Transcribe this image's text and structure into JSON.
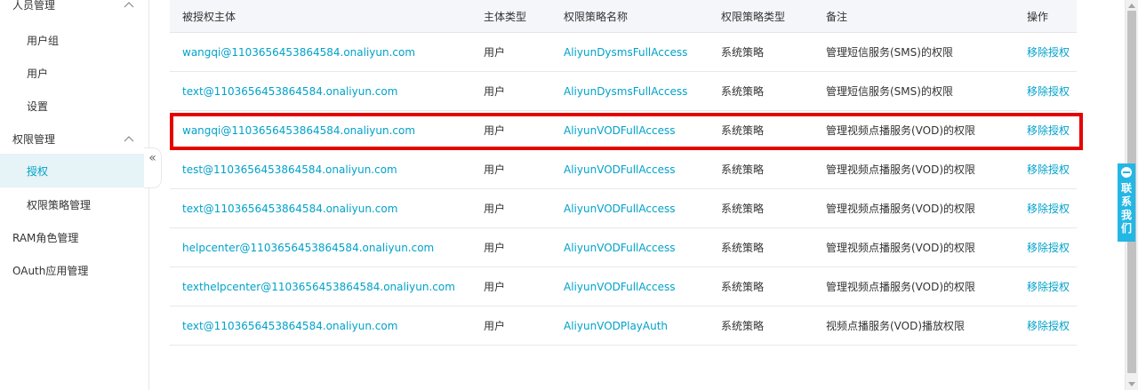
{
  "sidebar": {
    "items": [
      {
        "label": "人员管理",
        "kind": "group",
        "expanded": true
      },
      {
        "label": "用户组",
        "kind": "sub"
      },
      {
        "label": "用户",
        "kind": "sub"
      },
      {
        "label": "设置",
        "kind": "sub"
      },
      {
        "label": "权限管理",
        "kind": "group",
        "expanded": true
      },
      {
        "label": "授权",
        "kind": "sub",
        "active": true
      },
      {
        "label": "权限策略管理",
        "kind": "sub"
      },
      {
        "label": "RAM角色管理",
        "kind": "group"
      },
      {
        "label": "OAuth应用管理",
        "kind": "group"
      }
    ],
    "collapse_glyph": "«"
  },
  "table": {
    "columns": [
      "被授权主体",
      "主体类型",
      "权限策略名称",
      "权限策略类型",
      "备注",
      "操作"
    ],
    "rows": [
      {
        "principal": "wangqi@1103656453864584.onaliyun.com",
        "type": "用户",
        "policy": "AliyunDysmsFullAccess",
        "policy_type": "系统策略",
        "note": "管理短信服务(SMS)的权限",
        "action": "移除授权"
      },
      {
        "principal": "text@1103656453864584.onaliyun.com",
        "type": "用户",
        "policy": "AliyunDysmsFullAccess",
        "policy_type": "系统策略",
        "note": "管理短信服务(SMS)的权限",
        "action": "移除授权"
      },
      {
        "principal": "wangqi@1103656453864584.onaliyun.com",
        "type": "用户",
        "policy": "AliyunVODFullAccess",
        "policy_type": "系统策略",
        "note": "管理视频点播服务(VOD)的权限",
        "action": "移除授权"
      },
      {
        "principal": "test@1103656453864584.onaliyun.com",
        "type": "用户",
        "policy": "AliyunVODFullAccess",
        "policy_type": "系统策略",
        "note": "管理视频点播服务(VOD)的权限",
        "action": "移除授权"
      },
      {
        "principal": "text@1103656453864584.onaliyun.com",
        "type": "用户",
        "policy": "AliyunVODFullAccess",
        "policy_type": "系统策略",
        "note": "管理视频点播服务(VOD)的权限",
        "action": "移除授权"
      },
      {
        "principal": "helpcenter@1103656453864584.onaliyun.com",
        "type": "用户",
        "policy": "AliyunVODFullAccess",
        "policy_type": "系统策略",
        "note": "管理视频点播服务(VOD)的权限",
        "action": "移除授权"
      },
      {
        "principal": "texthelpcenter@1103656453864584.onaliyun.com",
        "type": "用户",
        "policy": "AliyunVODFullAccess",
        "policy_type": "系统策略",
        "note": "管理视频点播服务(VOD)的权限",
        "action": "移除授权"
      },
      {
        "principal": "text@1103656453864584.onaliyun.com",
        "type": "用户",
        "policy": "AliyunVODPlayAuth",
        "policy_type": "系统策略",
        "note": "视频点播服务(VOD)播放权限",
        "action": "移除授权"
      }
    ],
    "highlighted_row": 2
  },
  "contact_tab": {
    "label": "联系我们"
  },
  "colors": {
    "link": "#00a2ca",
    "highlight": "#e60000",
    "active_bg": "#e6f3f7",
    "contact": "#23b7e5"
  }
}
